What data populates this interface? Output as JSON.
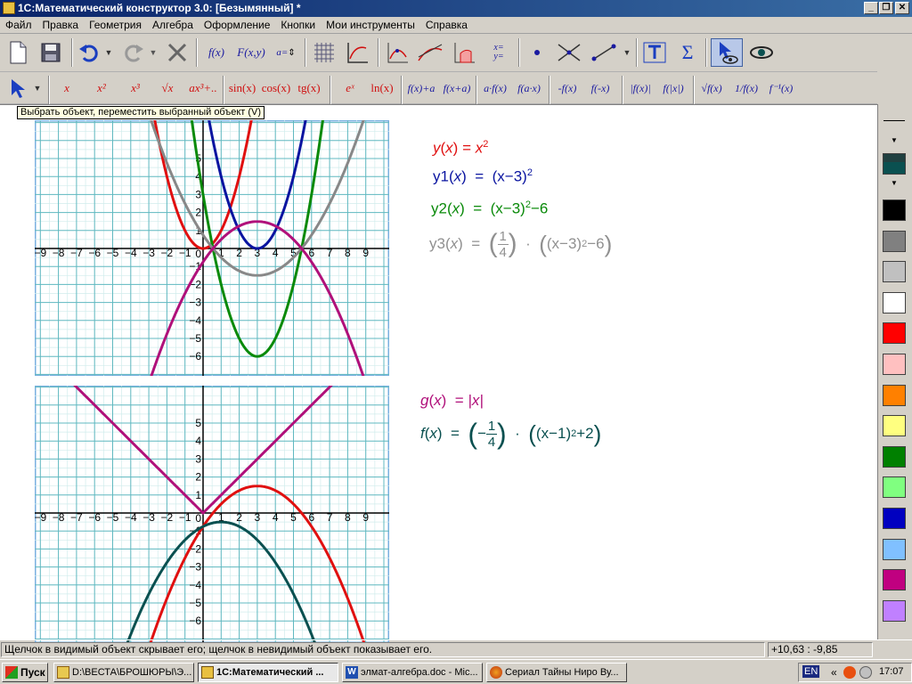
{
  "window": {
    "title": "1С:Математический конструктор 3.0: [Безымянный] *",
    "min": "_",
    "max": "❐",
    "close": "✕"
  },
  "menu": [
    "Файл",
    "Правка",
    "Геометрия",
    "Алгебра",
    "Оформление",
    "Кнопки",
    "Мои инструменты",
    "Справка"
  ],
  "toolbar2": {
    "x": "x",
    "x2": "x²",
    "x3": "x³",
    "sqrt": "√x",
    "poly": "ax³+..",
    "sin": "sin(x)",
    "cos": "cos(x)",
    "tg": "tg(x)",
    "exp": "eˣ",
    "ln": "ln(x)",
    "fxa": "f(x)+a",
    "fxpa": "f(x+a)",
    "afx": "a·f(x)",
    "fax": "f(a·x)",
    "negf": "-f(x)",
    "fneg": "f(-x)",
    "absf": "|f(x)|",
    "fabs": "f(|x|)",
    "sqrtf": "√f(x)",
    "inv": "1/f(x)",
    "finv": "f⁻¹(x)"
  },
  "toolbar1": {
    "fx": "f(x)",
    "fxy": "F(x,y)",
    "aeq": "a=",
    "xyeq": "x=\ny=",
    "sigma": "Σ"
  },
  "tooltip": "Выбрать объект, переместить выбранный объект (V)",
  "status": {
    "hint": "Щелчок в видимый объект скрывает его; щелчок в невидимый объект показывает его.",
    "coords": "+10,63 : -9,85"
  },
  "taskbar": {
    "start": "Пуск",
    "tasks": [
      "D:\\ВЕСТА\\БРОШЮРЫ\\Э...",
      "1С:Математический ...",
      "элмат-алгебра.doc - Mic...",
      "Сериал Тайны Ниро Ву..."
    ],
    "lang": "EN",
    "clock": "17:07",
    "tray": "«"
  },
  "colors": {
    "red": "#e01010",
    "blue": "#0a14a0",
    "green": "#0a8a0a",
    "gray": "#888888",
    "magenta": "#b0107a",
    "teal": "#0a5050"
  },
  "swatches": [
    "#000000",
    "#808080",
    "#c0c0c0",
    "#ffffff",
    "#ff0000",
    "#ffc0c0",
    "#ff8000",
    "#ffff80",
    "#008000",
    "#80ff80",
    "#0000c0",
    "#80c0ff",
    "#c00080",
    "#c080ff"
  ],
  "formulas1": {
    "y": {
      "name": "y",
      "x": "x",
      "eq": "=",
      "rhs": "x",
      "exp": "2"
    },
    "y1": {
      "name": "y1",
      "x": "x",
      "eq": "=",
      "rhs": "(x−3)",
      "exp": "2"
    },
    "y2": {
      "name": "y2",
      "x": "x",
      "eq": "=",
      "rhs": "(x−3)",
      "exp": "2",
      "tail": "−6"
    },
    "y3": {
      "name": "y3",
      "x": "x",
      "eq": "=",
      "num": "1",
      "den": "4",
      "dot": "·",
      "rhs": "(x−3)",
      "exp": "2",
      "tail": "−6"
    }
  },
  "formulas2": {
    "g": {
      "name": "g",
      "x": "x",
      "eq": "=",
      "rhs": "|x|"
    },
    "f": {
      "name": "f",
      "x": "x",
      "eq": "=",
      "sign": "−",
      "num": "1",
      "den": "4",
      "dot": "·",
      "rhs": "(x−1)",
      "exp": "2",
      "tail": "+2"
    }
  },
  "graph1": {
    "xrange": [
      -9,
      9
    ],
    "yrange": [
      -6,
      5
    ],
    "xticks": [
      "−9",
      "−8",
      "−7",
      "−6",
      "−5",
      "−4",
      "−3",
      "−2",
      "−1",
      "0",
      "1",
      "2",
      "3",
      "4",
      "5",
      "6",
      "7",
      "8",
      "9"
    ],
    "yticks": [
      "5",
      "4",
      "3",
      "2",
      "1",
      "−1",
      "−2",
      "−3",
      "−4",
      "−5",
      "−6"
    ]
  },
  "graph2": {
    "xrange": [
      -9,
      9
    ],
    "yrange": [
      -6,
      5
    ],
    "xticks": [
      "−9",
      "−8",
      "−7",
      "−6",
      "−5",
      "−4",
      "−3",
      "−2",
      "−1",
      "0",
      "1",
      "2",
      "3",
      "4",
      "5",
      "6",
      "7",
      "8",
      "9"
    ],
    "yticks": [
      "5",
      "4",
      "3",
      "2",
      "1",
      "−1",
      "−2",
      "−3",
      "−4",
      "−5",
      "−6"
    ]
  }
}
